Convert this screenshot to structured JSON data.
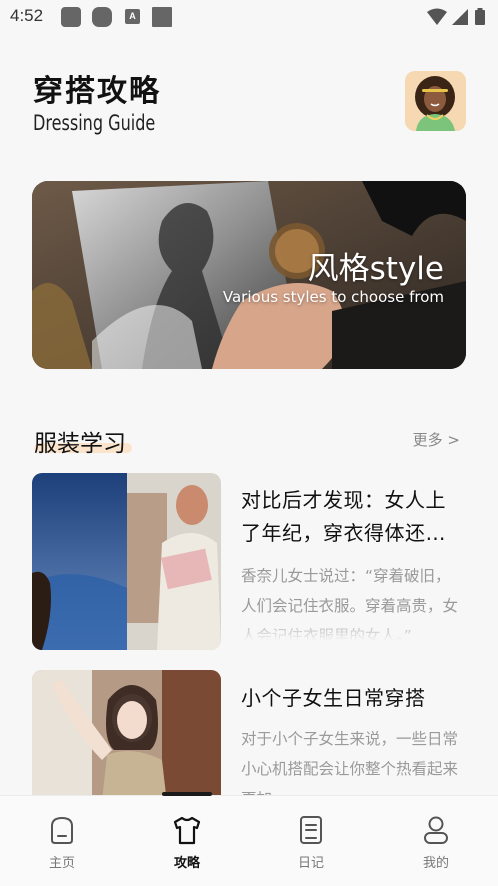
{
  "status_bar": {
    "time": "4:52",
    "notification_icons": [
      "app-icon",
      "app-icon",
      "text-icon",
      "app-icon"
    ],
    "notification_letter": "A",
    "right_icons": [
      "wifi-icon",
      "signal-icon",
      "battery-icon"
    ]
  },
  "header": {
    "title_cn": "穿搭攻略",
    "title_en": "Dressing Guide",
    "avatar_icon": "avatar-cartoon-woman"
  },
  "banner": {
    "title": "风格style",
    "subtitle": "Various styles to choose from"
  },
  "section": {
    "title": "服装学习",
    "more_label": "更多 >"
  },
  "articles": [
    {
      "title": "对比后才发现：女人上了年纪，穿衣得体还…",
      "description": "香奈儿女士说过：“穿着破旧，人们会记住衣服。穿着高贵，女人会记住衣服里的女人。”"
    },
    {
      "title": "小个子女生日常穿搭",
      "description": "对于小个子女生来说，一些日常小心机搭配会让你整个热看起来更加…"
    }
  ],
  "bottom_nav": {
    "items": [
      {
        "label": "主页",
        "icon": "home-icon",
        "active": false
      },
      {
        "label": "攻略",
        "icon": "shirt-icon",
        "active": true
      },
      {
        "label": "日记",
        "icon": "notebook-icon",
        "active": false
      },
      {
        "label": "我的",
        "icon": "profile-icon",
        "active": false
      }
    ]
  },
  "colors": {
    "background": "#f7f7f7",
    "accent_underline": "#fbe4cc",
    "text_primary": "#111111",
    "text_muted": "#9a9a9a"
  }
}
